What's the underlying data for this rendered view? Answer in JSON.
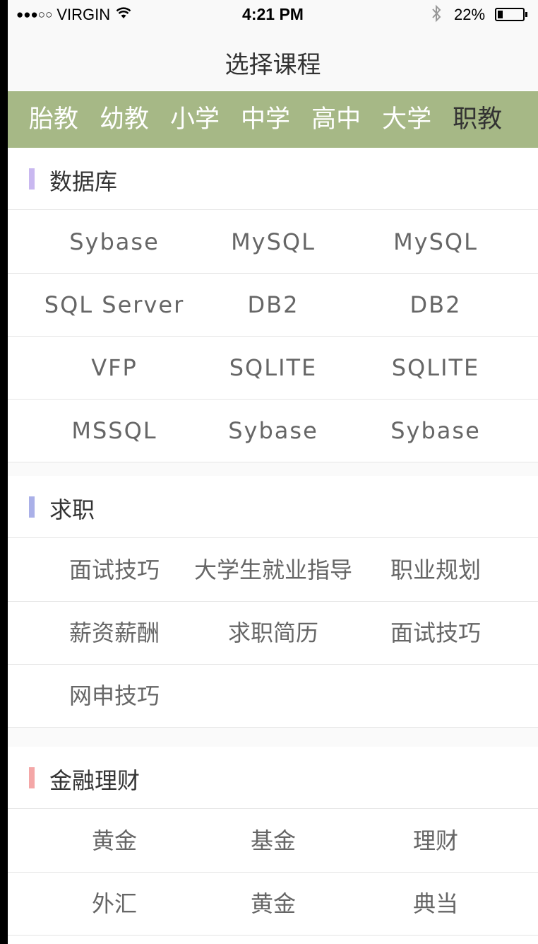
{
  "status_bar": {
    "signal": "●●●○○",
    "carrier": "VIRGIN",
    "time": "4:21 PM",
    "battery": "22%",
    "battery_level": 0.22
  },
  "nav": {
    "title": "选择课程"
  },
  "tabs": [
    {
      "label": "胎教",
      "active": false
    },
    {
      "label": "幼教",
      "active": false
    },
    {
      "label": "小学",
      "active": false
    },
    {
      "label": "中学",
      "active": false
    },
    {
      "label": "高中",
      "active": false
    },
    {
      "label": "大学",
      "active": false
    },
    {
      "label": "职教",
      "active": true
    }
  ],
  "sections": [
    {
      "title": "数据库",
      "accent": "#c9b8f0",
      "rows": [
        [
          "Sybase",
          "MySQL",
          "MySQL"
        ],
        [
          "SQL Server",
          "DB2",
          "DB2"
        ],
        [
          "VFP",
          "SQLITE",
          "SQLITE"
        ],
        [
          "MSSQL",
          "Sybase",
          "Sybase"
        ]
      ]
    },
    {
      "title": "求职",
      "accent": "#aab0e8",
      "rows": [
        [
          "面试技巧",
          "大学生就业指导",
          "职业规划"
        ],
        [
          "薪资薪酬",
          "求职简历",
          "面试技巧"
        ],
        [
          "网申技巧",
          "",
          ""
        ]
      ]
    },
    {
      "title": "金融理财",
      "accent": "#f4a7a7",
      "rows": [
        [
          "黄金",
          "基金",
          "理财"
        ],
        [
          "外汇",
          "黄金",
          "典当"
        ]
      ]
    }
  ],
  "colors": {
    "tab_bg": "#a6b886",
    "tab_text": "#ffffff",
    "title_text": "#333333",
    "cell_text": "#666666",
    "divider": "#e5e5e5",
    "gap_bg": "#fafafa"
  }
}
